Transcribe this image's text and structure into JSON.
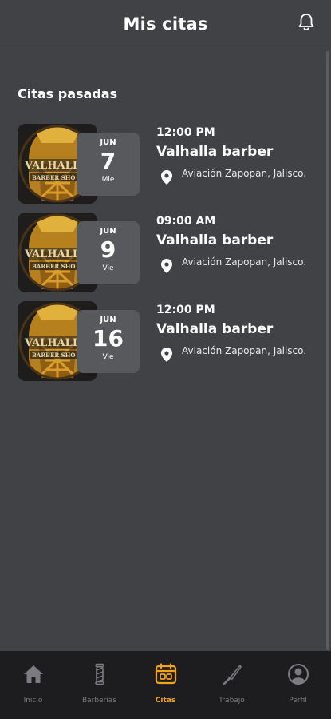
{
  "header": {
    "title": "Mis citas"
  },
  "section": {
    "title": "Citas pasadas"
  },
  "thumb": {
    "logo_line1": "VALHALI",
    "logo_line2": "BARBER SHO"
  },
  "appointments": [
    {
      "time": "12:00 PM",
      "barber": "Valhalla barber",
      "address": "Aviación Zapopan, Jalisco.",
      "month": "JUN",
      "day": "7",
      "weekday": "Mie"
    },
    {
      "time": "09:00 AM",
      "barber": "Valhalla barber",
      "address": "Aviación Zapopan, Jalisco.",
      "month": "JUN",
      "day": "9",
      "weekday": "Vie"
    },
    {
      "time": "12:00 PM",
      "barber": "Valhalla barber",
      "address": "Aviación Zapopan, Jalisco.",
      "month": "JUN",
      "day": "16",
      "weekday": "Vie"
    }
  ],
  "nav": {
    "items": [
      {
        "label": "Inicio",
        "icon": "home-icon"
      },
      {
        "label": "Barberías",
        "icon": "barber-pole-icon"
      },
      {
        "label": "Citas",
        "icon": "calendar-icon"
      },
      {
        "label": "Trabajo",
        "icon": "razor-icon"
      },
      {
        "label": "Perfil",
        "icon": "user-icon"
      }
    ],
    "active_color": "#f2a31b",
    "inactive_color": "#7c7c80"
  }
}
